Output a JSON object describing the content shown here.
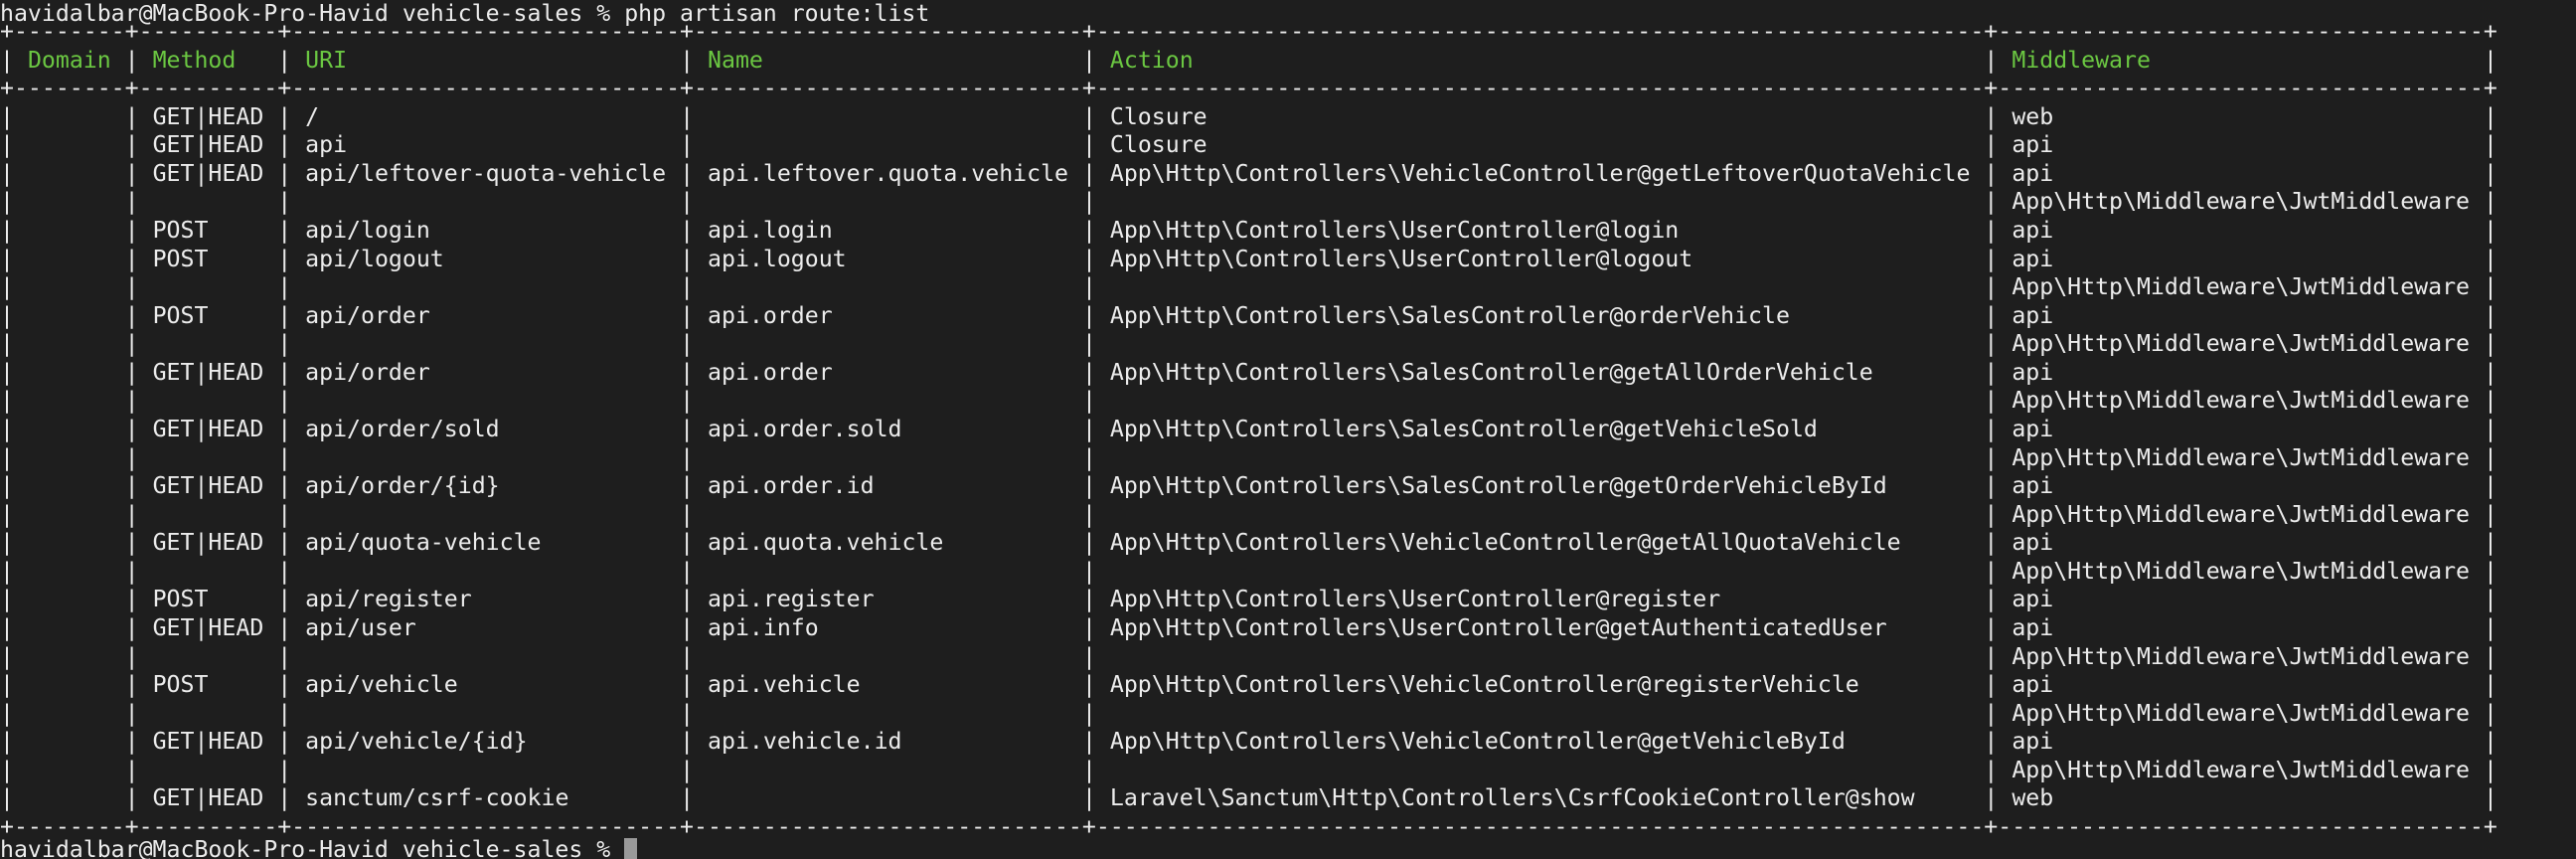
{
  "terminal": {
    "command_line": "havidalbar@MacBook-Pro-Havid vehicle-sales % php artisan route:list",
    "prompt": "havidalbar@MacBook-Pro-Havid vehicle-sales % "
  },
  "colors": {
    "background": "#1e1e1e",
    "foreground": "#ececec",
    "header": "#6bc742",
    "cursor": "#9a9a9a"
  },
  "table": {
    "columns": [
      "Domain",
      "Method",
      "URI",
      "Name",
      "Action",
      "Middleware"
    ],
    "rows": [
      [
        "",
        "GET|HEAD",
        "/",
        "",
        "Closure",
        "web"
      ],
      [
        "",
        "GET|HEAD",
        "api",
        "",
        "Closure",
        "api"
      ],
      [
        "",
        "GET|HEAD",
        "api/leftover-quota-vehicle",
        "api.leftover.quota.vehicle",
        "App\\Http\\Controllers\\VehicleController@getLeftoverQuotaVehicle",
        "api"
      ],
      [
        "",
        "",
        "",
        "",
        "",
        "App\\Http\\Middleware\\JwtMiddleware"
      ],
      [
        "",
        "POST",
        "api/login",
        "api.login",
        "App\\Http\\Controllers\\UserController@login",
        "api"
      ],
      [
        "",
        "POST",
        "api/logout",
        "api.logout",
        "App\\Http\\Controllers\\UserController@logout",
        "api"
      ],
      [
        "",
        "",
        "",
        "",
        "",
        "App\\Http\\Middleware\\JwtMiddleware"
      ],
      [
        "",
        "POST",
        "api/order",
        "api.order",
        "App\\Http\\Controllers\\SalesController@orderVehicle",
        "api"
      ],
      [
        "",
        "",
        "",
        "",
        "",
        "App\\Http\\Middleware\\JwtMiddleware"
      ],
      [
        "",
        "GET|HEAD",
        "api/order",
        "api.order",
        "App\\Http\\Controllers\\SalesController@getAllOrderVehicle",
        "api"
      ],
      [
        "",
        "",
        "",
        "",
        "",
        "App\\Http\\Middleware\\JwtMiddleware"
      ],
      [
        "",
        "GET|HEAD",
        "api/order/sold",
        "api.order.sold",
        "App\\Http\\Controllers\\SalesController@getVehicleSold",
        "api"
      ],
      [
        "",
        "",
        "",
        "",
        "",
        "App\\Http\\Middleware\\JwtMiddleware"
      ],
      [
        "",
        "GET|HEAD",
        "api/order/{id}",
        "api.order.id",
        "App\\Http\\Controllers\\SalesController@getOrderVehicleById",
        "api"
      ],
      [
        "",
        "",
        "",
        "",
        "",
        "App\\Http\\Middleware\\JwtMiddleware"
      ],
      [
        "",
        "GET|HEAD",
        "api/quota-vehicle",
        "api.quota.vehicle",
        "App\\Http\\Controllers\\VehicleController@getAllQuotaVehicle",
        "api"
      ],
      [
        "",
        "",
        "",
        "",
        "",
        "App\\Http\\Middleware\\JwtMiddleware"
      ],
      [
        "",
        "POST",
        "api/register",
        "api.register",
        "App\\Http\\Controllers\\UserController@register",
        "api"
      ],
      [
        "",
        "GET|HEAD",
        "api/user",
        "api.info",
        "App\\Http\\Controllers\\UserController@getAuthenticatedUser",
        "api"
      ],
      [
        "",
        "",
        "",
        "",
        "",
        "App\\Http\\Middleware\\JwtMiddleware"
      ],
      [
        "",
        "POST",
        "api/vehicle",
        "api.vehicle",
        "App\\Http\\Controllers\\VehicleController@registerVehicle",
        "api"
      ],
      [
        "",
        "",
        "",
        "",
        "",
        "App\\Http\\Middleware\\JwtMiddleware"
      ],
      [
        "",
        "GET|HEAD",
        "api/vehicle/{id}",
        "api.vehicle.id",
        "App\\Http\\Controllers\\VehicleController@getVehicleById",
        "api"
      ],
      [
        "",
        "",
        "",
        "",
        "",
        "App\\Http\\Middleware\\JwtMiddleware"
      ],
      [
        "",
        "GET|HEAD",
        "sanctum/csrf-cookie",
        "",
        "Laravel\\Sanctum\\Http\\Controllers\\CsrfCookieController@show",
        "web"
      ]
    ]
  }
}
